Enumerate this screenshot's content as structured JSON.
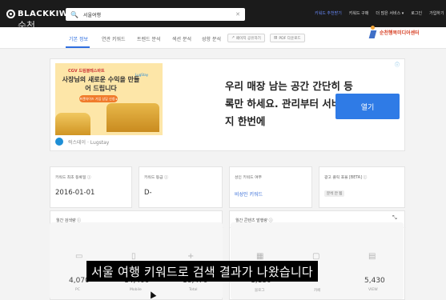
{
  "header": {
    "brand": "BLACKKIWI",
    "search": {
      "value": "서울여행",
      "placeholder": ""
    },
    "nav": [
      "키워드 추천받기",
      "키워드 구매",
      "더 많은 서비스 ▾",
      "로그인",
      "가입하기"
    ]
  },
  "watermark": {
    "left_line1": "순천",
    "left_line2": "이대",
    "right_text": "순천행복미디어센터"
  },
  "tabs": [
    "기본 정보",
    "연관 키워드",
    "트렌드 분석",
    "섹션 분석",
    "성향 분석"
  ],
  "active_tab": "기본 정보",
  "actions": {
    "share_label": "페이지 공유하기",
    "pdf_label": "PDF 다운로드"
  },
  "ad": {
    "brand_small": "CGV 드림블레스바트",
    "image_headline": "사장님의 새로운 수익을 만들어 드립니다",
    "image_cta": "프랜차이즈 가입 상담 신청 ▸",
    "image_tag": "LugStay",
    "headline": "우리 매장 남는 공간 간단히 등록만 하세요. 관리부터 서비스까지 한번에",
    "button": "열기",
    "advertiser": "럭스테이 · Lugstay",
    "info_icon": "ⓘ"
  },
  "cards": [
    {
      "label": "키워드 최초 등록일 ⓘ",
      "value": "2016-01-01"
    },
    {
      "label": "키워드 등급 ⓘ",
      "value": "D-"
    },
    {
      "label": "성인 키워드 여부",
      "value": "비성인 키워드"
    },
    {
      "label": "광고 클릭 효율 [BETA] ⓘ",
      "value": "분석 안 됨"
    }
  ],
  "panels": {
    "search_volume": {
      "title": "월간 검색량 ⓘ"
    },
    "content_publish": {
      "title": "월간 콘텐츠 발행량 ⓘ"
    }
  },
  "metrics": [
    {
      "value": "4,070",
      "label": "PC",
      "icon": "monitor-icon"
    },
    {
      "value": "14,400",
      "label": "Mobile",
      "icon": "phone-icon"
    },
    {
      "value": "18,470",
      "label": "Total",
      "icon": "plus-icon"
    },
    {
      "value": "1,130",
      "label": "블로그",
      "icon": "blog-icon"
    },
    {
      "value": "",
      "label": "카페",
      "icon": "cafe-icon"
    },
    {
      "value": "5,430",
      "label": "VIEW",
      "icon": "view-icon"
    }
  ],
  "caption": "서울 여행 키워드로 검색 결과가 나왔습니다",
  "colors": {
    "accent": "#2f6fe0",
    "topbar": "#1b1b1b",
    "ad_button": "#2f7be6"
  }
}
